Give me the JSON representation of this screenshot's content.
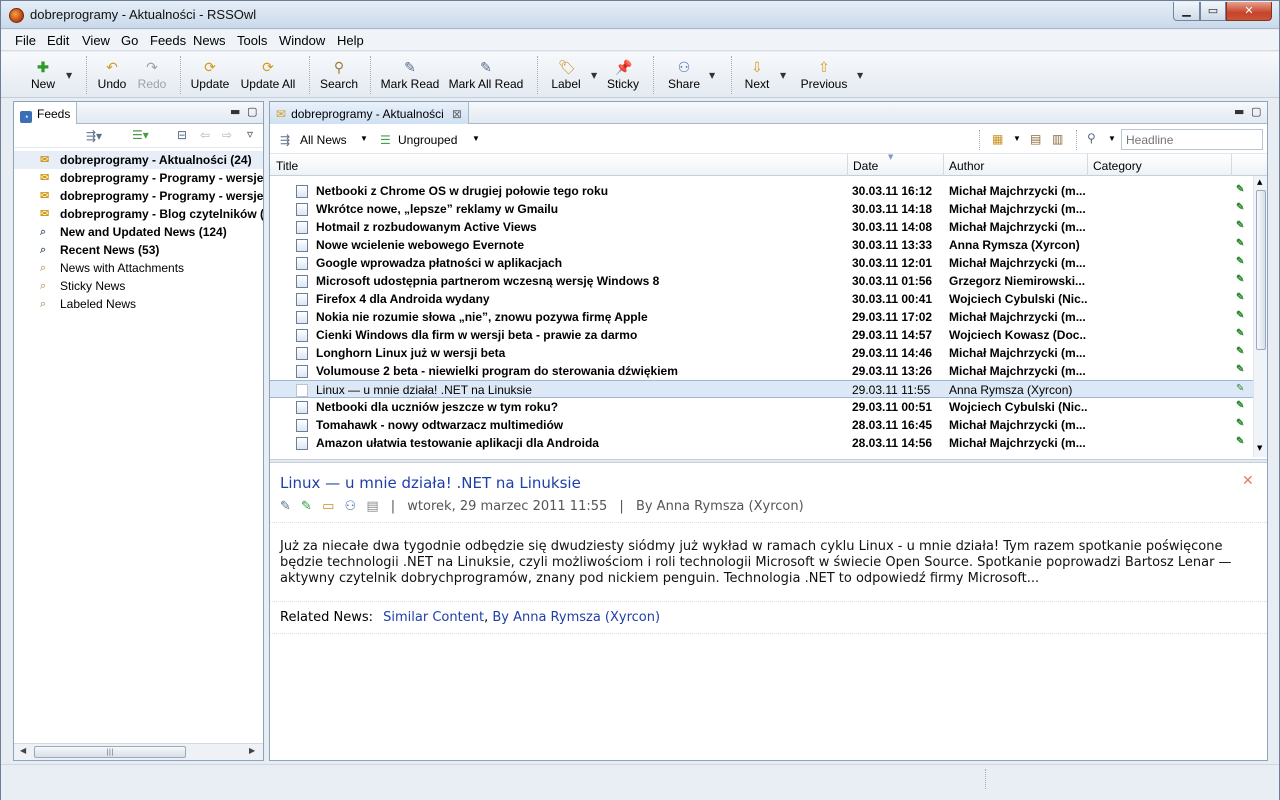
{
  "window": {
    "title": "dobreprogramy - Aktualności - RSSOwl"
  },
  "menu": [
    "File",
    "Edit",
    "View",
    "Go",
    "Feeds",
    "News",
    "Tools",
    "Window",
    "Help"
  ],
  "toolbar": {
    "new": "New",
    "undo": "Undo",
    "redo": "Redo",
    "update": "Update",
    "update_all": "Update All",
    "search": "Search",
    "mark_read": "Mark Read",
    "mark_all_read": "Mark All Read",
    "label": "Label",
    "sticky": "Sticky",
    "share": "Share",
    "next": "Next",
    "previous": "Previous"
  },
  "feeds_panel": {
    "tab": "Feeds",
    "items": [
      {
        "label": "dobreprogramy - Aktualności (24)",
        "bold": true
      },
      {
        "label": "dobreprogramy - Programy - wersje",
        "bold": true
      },
      {
        "label": "dobreprogramy - Programy - wersje",
        "bold": true
      },
      {
        "label": "dobreprogramy - Blog czytelników (",
        "bold": true
      },
      {
        "label": "New and Updated News (124)",
        "bold": true
      },
      {
        "label": "Recent News (53)",
        "bold": true
      },
      {
        "label": "News with Attachments",
        "bold": false
      },
      {
        "label": "Sticky News",
        "bold": false
      },
      {
        "label": "Labeled News",
        "bold": false
      }
    ]
  },
  "news_panel": {
    "tab": "dobreprogramy - Aktualności",
    "filter": "All News",
    "grouping": "Ungrouped",
    "search_placeholder": "Headline",
    "columns": {
      "title": "Title",
      "date": "Date",
      "author": "Author",
      "category": "Category"
    },
    "rows": [
      {
        "title": "Netbooki z Chrome OS w drugiej połowie tego roku",
        "date": "30.03.11 16:12",
        "author": "Michał Majchrzycki (m...",
        "unread": true
      },
      {
        "title": "Wkrótce nowe, „lepsze” reklamy w Gmailu",
        "date": "30.03.11 14:18",
        "author": "Michał Majchrzycki (m...",
        "unread": true
      },
      {
        "title": "Hotmail z rozbudowanym Active Views",
        "date": "30.03.11 14:08",
        "author": "Michał Majchrzycki (m...",
        "unread": true
      },
      {
        "title": "Nowe wcielenie webowego Evernote",
        "date": "30.03.11 13:33",
        "author": "Anna Rymsza (Xyrcon)",
        "unread": true
      },
      {
        "title": "Google wprowadza płatności w aplikacjach",
        "date": "30.03.11 12:01",
        "author": "Michał Majchrzycki (m...",
        "unread": true
      },
      {
        "title": "Microsoft udostępnia partnerom wczesną wersję Windows 8",
        "date": "30.03.11 01:56",
        "author": "Grzegorz Niemirowski...",
        "unread": true
      },
      {
        "title": "Firefox 4 dla Androida wydany",
        "date": "30.03.11 00:41",
        "author": "Wojciech Cybulski (Nic...",
        "unread": true
      },
      {
        "title": "Nokia nie rozumie słowa „nie”, znowu pozywa firmę Apple",
        "date": "29.03.11 17:02",
        "author": "Michał Majchrzycki (m...",
        "unread": true
      },
      {
        "title": "Cienki Windows dla firm w wersji beta - prawie za darmo",
        "date": "29.03.11 14:57",
        "author": "Wojciech Kowasz (Doc...",
        "unread": true
      },
      {
        "title": "Longhorn Linux już w wersji beta",
        "date": "29.03.11 14:46",
        "author": "Michał Majchrzycki (m...",
        "unread": true
      },
      {
        "title": "Volumouse 2 beta - niewielki program do sterowania dźwiękiem",
        "date": "29.03.11 13:26",
        "author": "Michał Majchrzycki (m...",
        "unread": true
      },
      {
        "title": "Linux — u mnie działa! .NET na Linuksie",
        "date": "29.03.11 11:55",
        "author": "Anna Rymsza (Xyrcon)",
        "unread": false
      },
      {
        "title": "Netbooki dla uczniów jeszcze w tym roku?",
        "date": "29.03.11 00:51",
        "author": "Wojciech Cybulski (Nic...",
        "unread": true
      },
      {
        "title": "Tomahawk - nowy odtwarzacz multimediów",
        "date": "28.03.11 16:45",
        "author": "Michał Majchrzycki (m...",
        "unread": true
      },
      {
        "title": "Amazon ułatwia testowanie aplikacji dla Androida",
        "date": "28.03.11 14:56",
        "author": "Michał Majchrzycki (m...",
        "unread": true
      }
    ]
  },
  "reader": {
    "title": "Linux — u mnie działa! .NET na Linuksie",
    "sep1": "|",
    "date": "wtorek, 29 marzec 2011 11:55",
    "sep2": "|",
    "by": "By Anna Rymsza (Xyrcon)",
    "body": "Już za niecałe dwa tygodnie odbędzie się dwudziesty siódmy już wykład w ramach cyklu Linux - u mnie działa! Tym razem spotkanie poświęcone będzie technologii .NET na Linuksie, czyli możliwościom i roli technologii Microsoft w świecie Open Source. Spotkanie poprowadzi Bartosz Lenar — aktywny czytelnik dobrychprogramów, znany pod nickiem penguin. Technologia .NET to odpowiedź firmy Microsoft...",
    "related_label": "Related News:",
    "related_similar": "Similar Content",
    "related_comma": ",",
    "related_by": "By Anna Rymsza (Xyrcon)"
  }
}
